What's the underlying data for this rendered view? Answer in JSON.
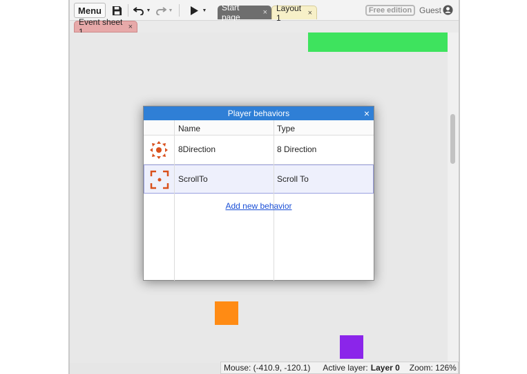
{
  "toolbar": {
    "menu_label": "Menu",
    "tabs": [
      {
        "label": "Start page",
        "close": "×"
      },
      {
        "label": "Layout 1",
        "close": "×"
      }
    ],
    "free_edition_label": "Free edition",
    "guest_label": "Guest"
  },
  "secondary_tabs": [
    {
      "label": "Event sheet 1",
      "close": "×"
    }
  ],
  "dialog": {
    "title": "Player behaviors",
    "close": "×",
    "columns": {
      "name": "Name",
      "type": "Type"
    },
    "rows": [
      {
        "name": "8Direction",
        "type": "8 Direction",
        "icon": "eight-direction-icon"
      },
      {
        "name": "ScrollTo",
        "type": "Scroll To",
        "icon": "scroll-to-icon"
      }
    ],
    "add_link": "Add new behavior"
  },
  "statusbar": {
    "mouse": "Mouse: (-410.9, -120.1)",
    "active_layer_prefix": "Active layer:",
    "active_layer_value": "Layer 0",
    "zoom": "Zoom: 126%"
  },
  "colors": {
    "accent_blue": "#2f7fd6",
    "green_object": "#3ee35e",
    "orange_object": "#ff8b14",
    "purple_object": "#8b25ea",
    "behavior_icon": "#d9501c"
  }
}
